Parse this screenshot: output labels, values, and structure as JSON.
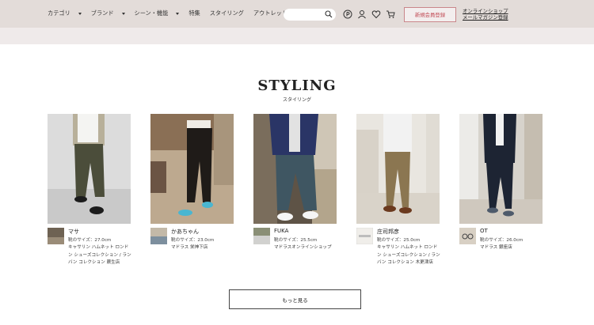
{
  "header": {
    "nav": [
      {
        "label": "カテゴリ",
        "has_caret": true
      },
      {
        "label": "ブランド",
        "has_caret": true
      },
      {
        "label": "シーン・機能",
        "has_caret": true
      },
      {
        "label": "特集",
        "has_caret": false
      },
      {
        "label": "スタイリング",
        "has_caret": false
      },
      {
        "label": "アウトレット",
        "has_caret": false
      }
    ],
    "search_placeholder": "",
    "member_button": "新規会員登録",
    "shop_link_line1": "オンラインショップ",
    "shop_link_line2": "メールマガジン登録",
    "icons": [
      "store-icon",
      "account-icon",
      "favorite-icon",
      "cart-icon"
    ]
  },
  "section": {
    "title": "STYLING",
    "subtitle": "スタイリング"
  },
  "cards": [
    {
      "name": "マサ",
      "size": "靴のサイズ：27.0cm",
      "store": "キャサリン ハムネット ロンドン シューズコレクション / ランバン コレクション 蕨生店"
    },
    {
      "name": "かあちゃん",
      "size": "靴のサイズ：23.0cm",
      "store": "マドラス 栄神下店"
    },
    {
      "name": "FUKA",
      "size": "靴のサイズ：25.5cm",
      "store": "マドラスオンラインショップ"
    },
    {
      "name": "庄司邦彦",
      "size": "靴のサイズ：25.0cm",
      "store": "キャサリン ハムネット ロンドン シューズコレクション / ランバン コレクション 木更津店"
    },
    {
      "name": "OT",
      "size": "靴のサイズ：26.0cm",
      "store": "マドラス 銀座店"
    }
  ],
  "more_button": "もっと見る",
  "colors": {
    "header_bg": "#e3dcd9",
    "accent": "#c14b55"
  }
}
